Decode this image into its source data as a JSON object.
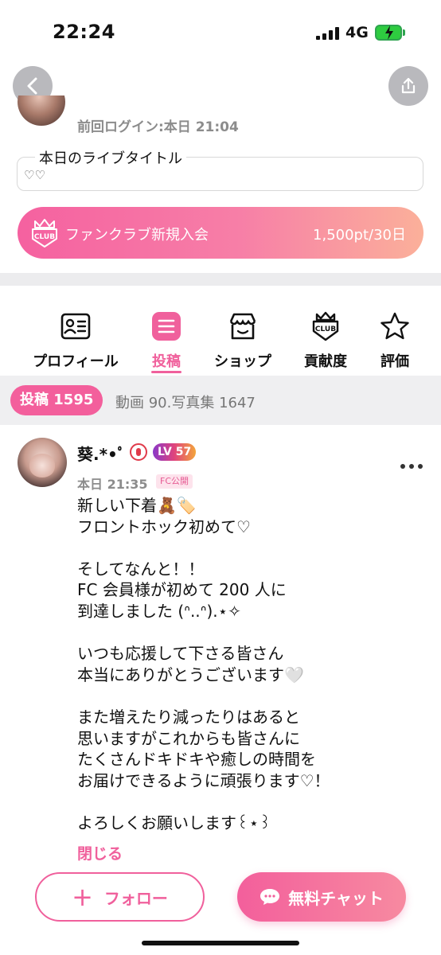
{
  "status_bar": {
    "time": "22:24",
    "network": "4G"
  },
  "profile": {
    "last_login": "前回ログイン:本日 21:04"
  },
  "live_title": {
    "label": "本日のライブタイトル",
    "value": "♡♡"
  },
  "fanclub": {
    "label": "ファンクラブ新規入会",
    "price": "1,500pt/30日",
    "badge_text": "CLUB"
  },
  "tabs": [
    {
      "label": "プロフィール",
      "icon": "profile-card-icon"
    },
    {
      "label": "投稿",
      "icon": "post-list-icon",
      "active": true
    },
    {
      "label": "ショップ",
      "icon": "shop-icon"
    },
    {
      "label": "貢献度",
      "icon": "club-badge-icon"
    },
    {
      "label": "評価",
      "icon": "star-icon"
    }
  ],
  "subtabs": {
    "posts": "投稿 1595",
    "media": "動画 90.写真集 1647"
  },
  "post": {
    "author": "葵.*•ﾟ",
    "level": "LV 57",
    "time": "本日 21:35",
    "visibility": "FC公開",
    "body": "新しい下着🧸🏷️\nフロントホック初めて♡\n\nそしてなんと！！\nFC 会員様が初めて 200 人に\n到達しました (ᐢ..ᐢ).⋆✧\n\nいつも応援して下さる皆さん\n本当にありがとうございます🤍\n\nまた増えたり減ったりはあると\n思いますがこれからも皆さんに\nたくさんドキドキや癒しの時間を\nお届けできるように頑張ります♡！\n\nよろしくお願いします꒰⋆︎꒱︎",
    "close_label": "閉じる"
  },
  "actions": {
    "follow_label": "フォロー",
    "chat_label": "無料チャット"
  },
  "colors": {
    "accent": "#f0609c",
    "accent_gradient_end": "#fbb09a"
  }
}
